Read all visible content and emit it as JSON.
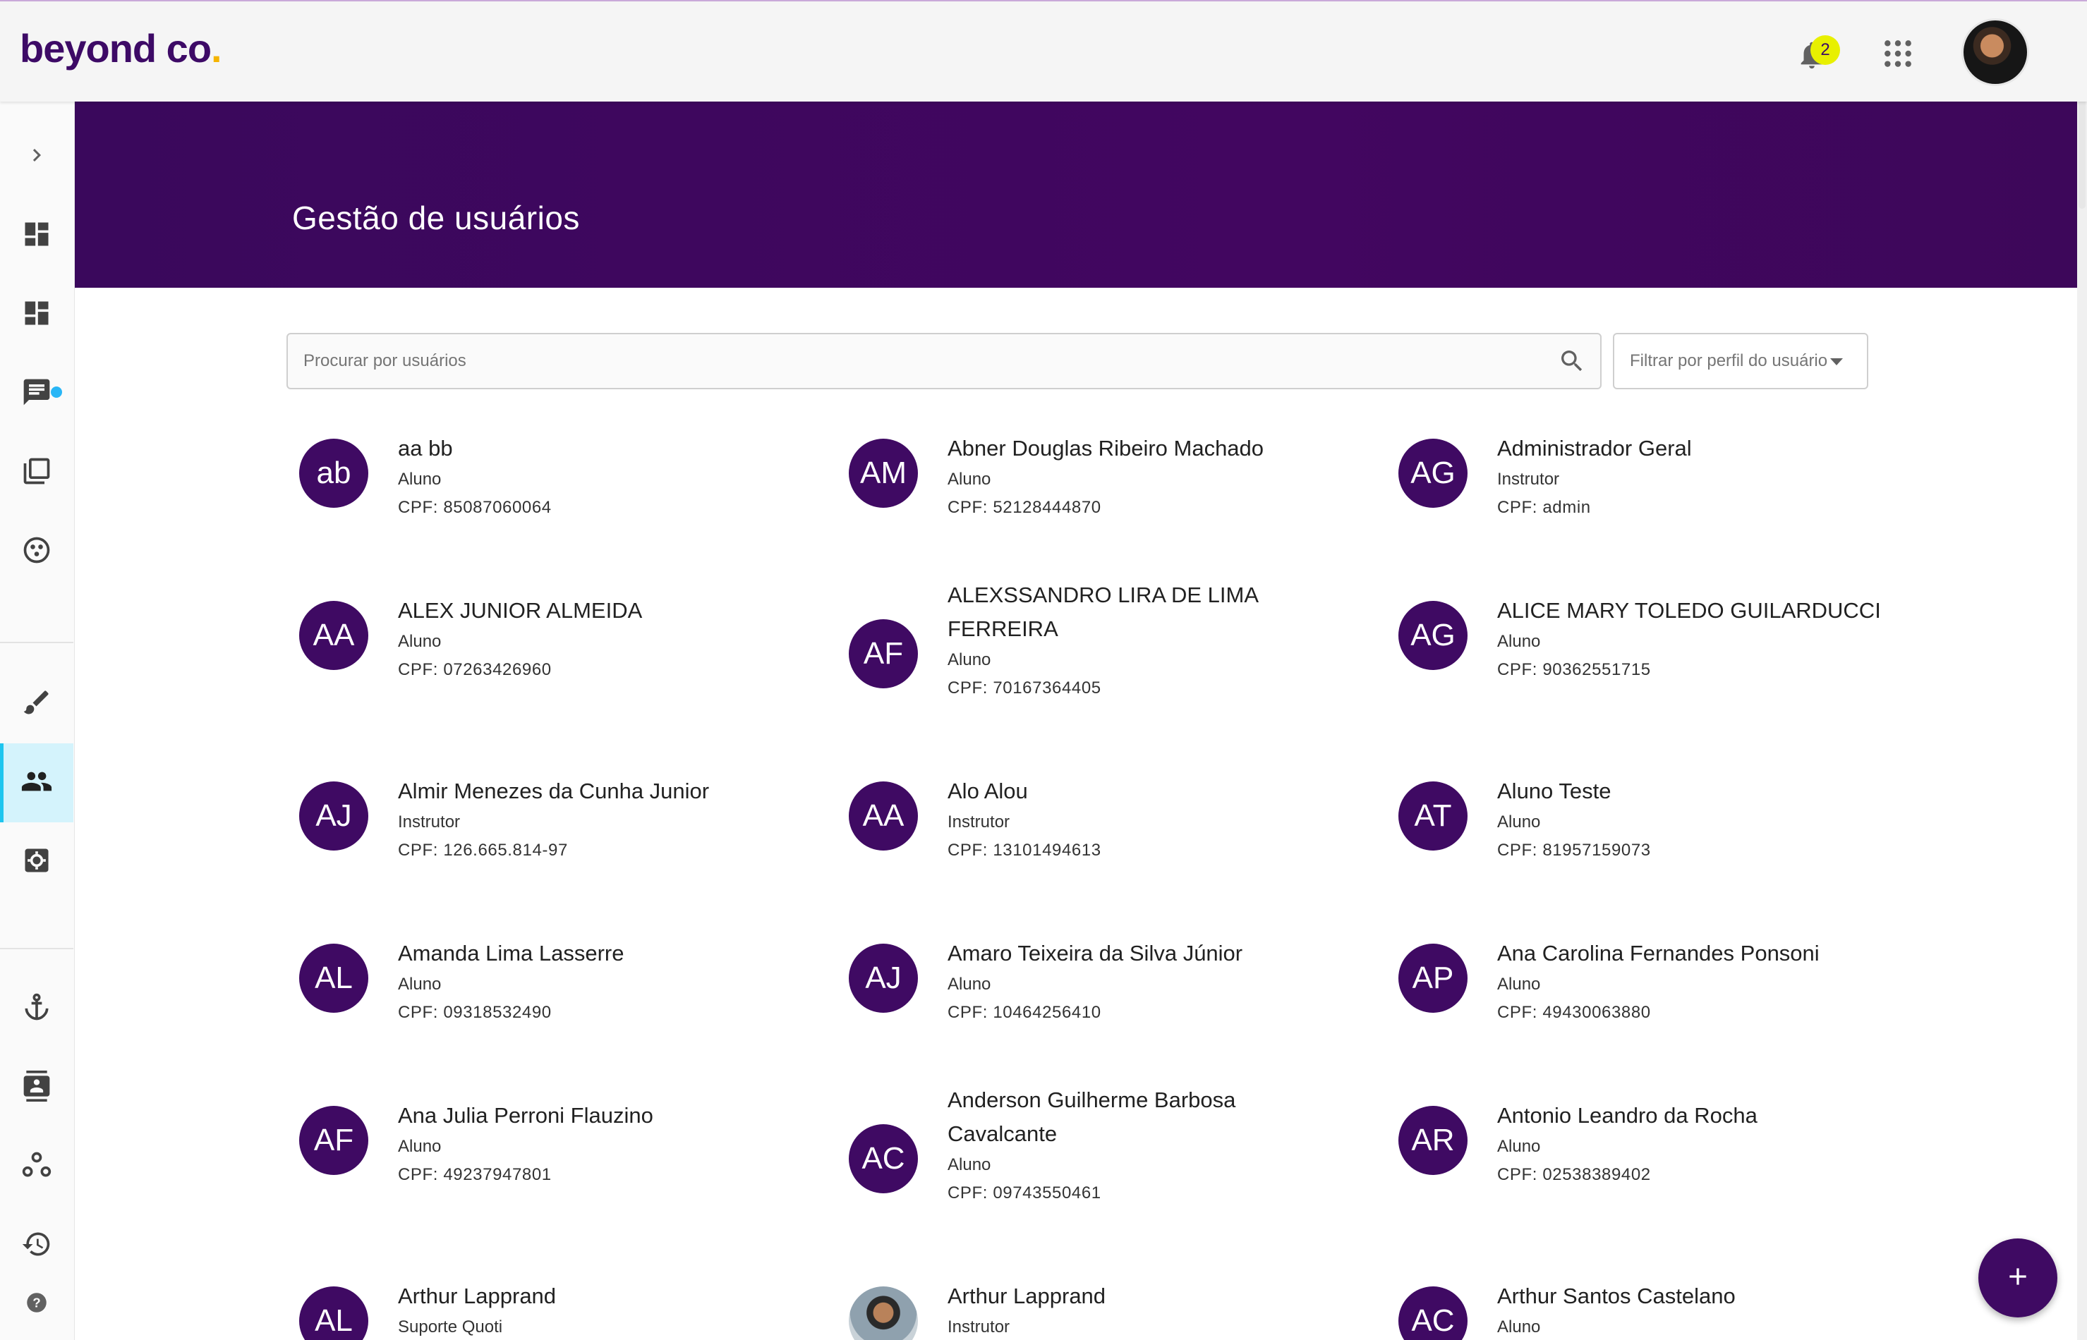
{
  "brand": {
    "name": "beyond co",
    "dot": "."
  },
  "header": {
    "notification_count": "2"
  },
  "banner": {
    "title": "Gestão de usuários"
  },
  "search": {
    "placeholder": "Procurar por usuários"
  },
  "filter": {
    "label": "Filtrar por perfil do usuário"
  },
  "sidebar": {
    "items": [
      {
        "icon": "chevron-right-icon"
      },
      {
        "icon": "dashboard-icon"
      },
      {
        "icon": "dashboard-alt-icon"
      },
      {
        "icon": "chat-icon",
        "has_dot": true
      },
      {
        "icon": "library-icon"
      },
      {
        "icon": "tokens-icon"
      },
      {
        "icon": "brush-icon"
      },
      {
        "icon": "people-icon",
        "active": true
      },
      {
        "icon": "settings-icon"
      },
      {
        "icon": "anchor-icon"
      },
      {
        "icon": "contacts-icon"
      },
      {
        "icon": "workflow-icon"
      },
      {
        "icon": "history-icon"
      },
      {
        "icon": "help-icon"
      }
    ]
  },
  "users": [
    {
      "initials": "ab",
      "name": "aa bb",
      "role": "Aluno",
      "cpf": "CPF: 85087060064"
    },
    {
      "initials": "AM",
      "name": "Abner Douglas Ribeiro Machado",
      "role": "Aluno",
      "cpf": "CPF: 52128444870"
    },
    {
      "initials": "AG",
      "name": "Administrador Geral",
      "role": "Instrutor",
      "cpf": "CPF: admin"
    },
    {
      "initials": "AA",
      "name": "ALEX JUNIOR ALMEIDA",
      "role": "Aluno",
      "cpf": "CPF: 07263426960"
    },
    {
      "initials": "AF",
      "name": "ALEXSSANDRO LIRA DE LIMA FERREIRA",
      "role": "Aluno",
      "cpf": "CPF: 70167364405"
    },
    {
      "initials": "AG",
      "name": "ALICE MARY TOLEDO GUILARDUCCI",
      "role": "Aluno",
      "cpf": "CPF: 90362551715"
    },
    {
      "initials": "AJ",
      "name": "Almir Menezes da Cunha Junior",
      "role": "Instrutor",
      "cpf": "CPF: 126.665.814-97"
    },
    {
      "initials": "AA",
      "name": "Alo Alou",
      "role": "Instrutor",
      "cpf": "CPF: 13101494613"
    },
    {
      "initials": "AT",
      "name": "Aluno Teste",
      "role": "Aluno",
      "cpf": "CPF: 81957159073"
    },
    {
      "initials": "AL",
      "name": "Amanda Lima Lasserre",
      "role": "Aluno",
      "cpf": "CPF: 09318532490"
    },
    {
      "initials": "AJ",
      "name": "Amaro Teixeira da Silva Júnior",
      "role": "Aluno",
      "cpf": "CPF: 10464256410"
    },
    {
      "initials": "AP",
      "name": "Ana Carolina Fernandes Ponsoni",
      "role": "Aluno",
      "cpf": "CPF: 49430063880"
    },
    {
      "initials": "AF",
      "name": "Ana Julia Perroni Flauzino",
      "role": "Aluno",
      "cpf": "CPF: 49237947801"
    },
    {
      "initials": "AC",
      "name": "Anderson Guilherme Barbosa Cavalcante",
      "role": "Aluno",
      "cpf": "CPF: 09743550461"
    },
    {
      "initials": "AR",
      "name": "Antonio Leandro da Rocha",
      "role": "Aluno",
      "cpf": "CPF: 02538389402"
    },
    {
      "initials": "AL",
      "name": "Arthur Lapprand",
      "role": "Suporte Quoti",
      "cpf": ""
    },
    {
      "initials": "",
      "name": "Arthur Lapprand",
      "role": "Instrutor",
      "cpf": ""
    },
    {
      "initials": "AC",
      "name": "Arthur Santos Castelano",
      "role": "Aluno",
      "cpf": ""
    }
  ]
}
